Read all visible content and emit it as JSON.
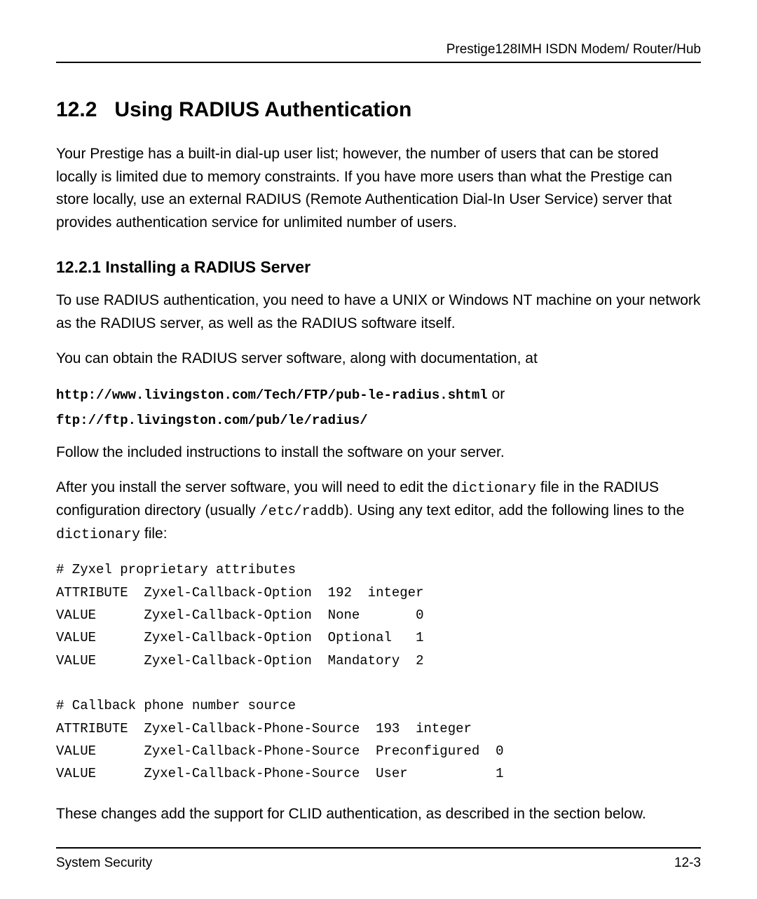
{
  "header": {
    "running_title": "Prestige128IMH  ISDN Modem/ Router/Hub"
  },
  "section": {
    "number": "12.2",
    "title": "Using RADIUS  Authentication",
    "intro_html": "Your Prestige has a built-in dial-up user list; however, the number of users that can be stored locally is limited due to memory constraints.  If you have more users than what the Prestige can store locally, use an external RADIUS (Remote Authentication Dial-In User Service) server that provides authentication service for unlimited number of users."
  },
  "subsection": {
    "heading": "12.2.1 Installing a RADIUS Server",
    "p1": "To use RADIUS authentication, you need to have a UNIX or Windows NT machine on your network as the RADIUS server, as well as the RADIUS software itself.",
    "p2": "You can obtain the RADIUS server software, along with documentation, at",
    "url1": "http://www.livingston.com/Tech/FTP/pub-le-radius.shtml",
    "or": " or",
    "url2": "ftp://ftp.livingston.com/pub/le/radius/",
    "p3": "Follow the included instructions to install the software on your server.",
    "p4_pre": "After you install the server software, you will need to edit the ",
    "dict1": "dictionary",
    "p4_mid": " file in the RADIUS configuration directory (usually ",
    "raddb": "/etc/raddb",
    "p4_mid2": "). Using any text editor, add the following lines to the ",
    "dict2": "dictionary",
    "p4_end": " file:",
    "code": "# Zyxel proprietary attributes\nATTRIBUTE  Zyxel-Callback-Option  192  integer\nVALUE      Zyxel-Callback-Option  None       0\nVALUE      Zyxel-Callback-Option  Optional   1\nVALUE      Zyxel-Callback-Option  Mandatory  2\n\n# Callback phone number source\nATTRIBUTE  Zyxel-Callback-Phone-Source  193  integer\nVALUE      Zyxel-Callback-Phone-Source  Preconfigured  0\nVALUE      Zyxel-Callback-Phone-Source  User           1",
    "closing": "These changes add the support for CLID authentication, as described in the section below."
  },
  "footer": {
    "left": "System Security",
    "right": "12-3"
  },
  "chart_data": {
    "type": "table",
    "title": "Zyxel RADIUS dictionary additions",
    "rows": [
      {
        "kind": "comment",
        "text": "# Zyxel proprietary attributes"
      },
      {
        "kind": "ATTRIBUTE",
        "name": "Zyxel-Callback-Option",
        "id": 192,
        "type": "integer"
      },
      {
        "kind": "VALUE",
        "attr": "Zyxel-Callback-Option",
        "value_name": "None",
        "value": 0
      },
      {
        "kind": "VALUE",
        "attr": "Zyxel-Callback-Option",
        "value_name": "Optional",
        "value": 1
      },
      {
        "kind": "VALUE",
        "attr": "Zyxel-Callback-Option",
        "value_name": "Mandatory",
        "value": 2
      },
      {
        "kind": "comment",
        "text": "# Callback phone number source"
      },
      {
        "kind": "ATTRIBUTE",
        "name": "Zyxel-Callback-Phone-Source",
        "id": 193,
        "type": "integer"
      },
      {
        "kind": "VALUE",
        "attr": "Zyxel-Callback-Phone-Source",
        "value_name": "Preconfigured",
        "value": 0
      },
      {
        "kind": "VALUE",
        "attr": "Zyxel-Callback-Phone-Source",
        "value_name": "User",
        "value": 1
      }
    ]
  }
}
